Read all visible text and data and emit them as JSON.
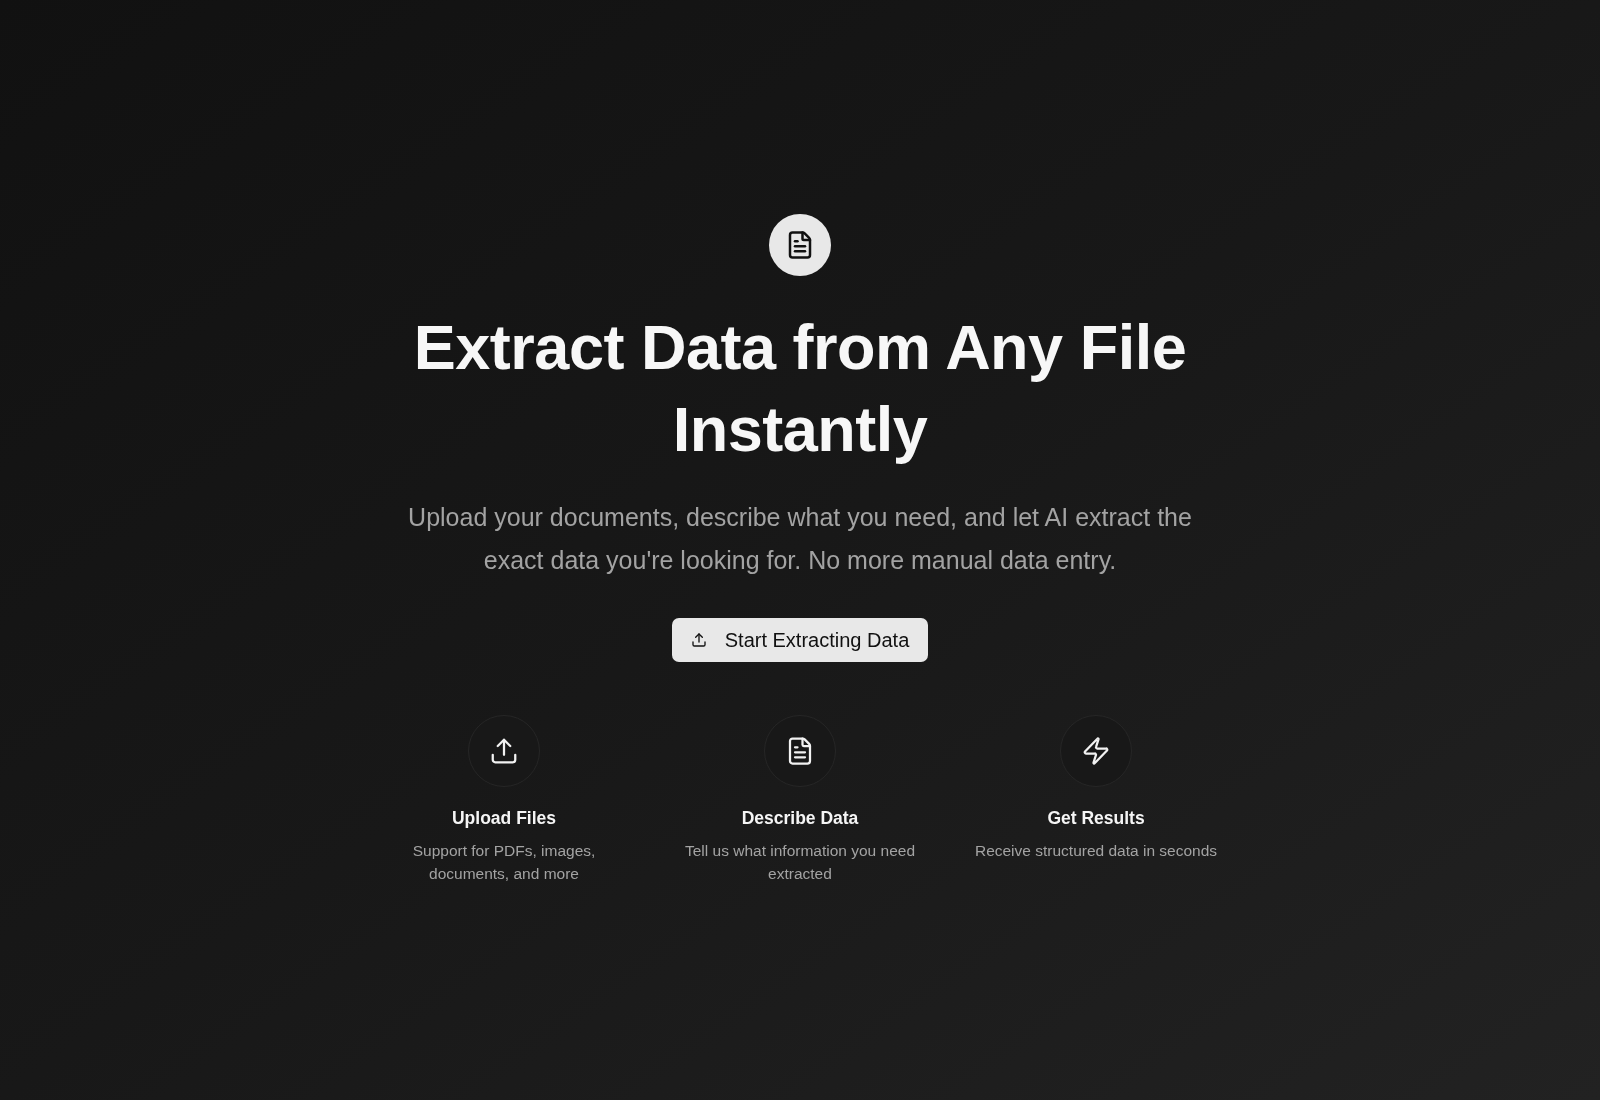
{
  "hero": {
    "title": "Extract Data from Any File Instantly",
    "subtitle": "Upload your documents, describe what you need, and let AI extract the exact data you're looking for. No more manual data entry.",
    "cta_button": {
      "label": "Start Extracting Data"
    }
  },
  "features": [
    {
      "kind": "upload",
      "title": "Upload Files",
      "description": "Support for PDFs, images, documents, and more"
    },
    {
      "kind": "document",
      "title": "Describe Data",
      "description": "Tell us what information you need extracted"
    },
    {
      "kind": "lightning",
      "title": "Get Results",
      "description": "Receive structured data in seconds"
    }
  ]
}
